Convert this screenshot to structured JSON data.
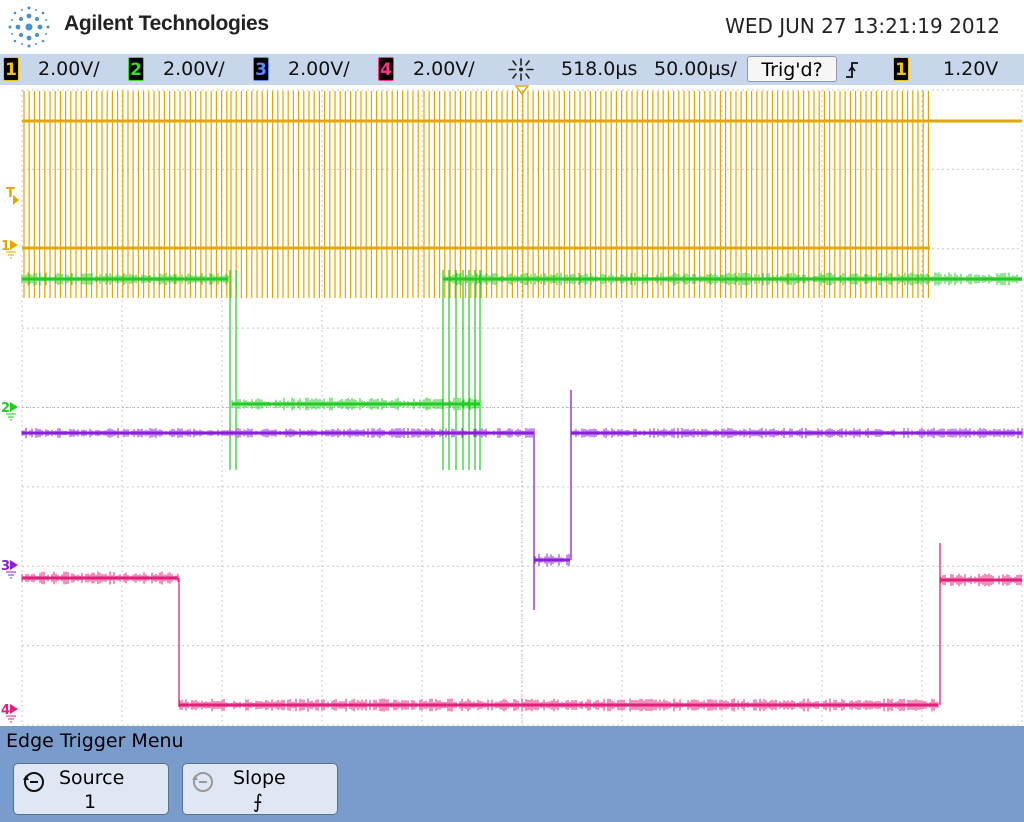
{
  "header": {
    "brand": "Agilent Technologies",
    "datetime": "WED JUN 27 13:21:19 2012"
  },
  "status_bar": {
    "channels": [
      {
        "number": "1",
        "scale": "2.00V/",
        "color": "#e8b400"
      },
      {
        "number": "2",
        "scale": "2.00V/",
        "color": "#33cc33"
      },
      {
        "number": "3",
        "scale": "2.00V/",
        "color": "#6688ff"
      },
      {
        "number": "4",
        "scale": "2.00V/",
        "color": "#ee2277"
      }
    ],
    "delay": "518.0µs",
    "timebase": "50.00µs/",
    "trigger_state": "Trig'd?",
    "trigger_slope_icon": "rising-edge-icon",
    "trigger_source": "1",
    "trigger_level": "1.20V"
  },
  "markers": {
    "trigger": "T",
    "ch1": "1",
    "ch2": "2",
    "ch3": "3",
    "ch4": "4"
  },
  "traces": {
    "ch1_color": "#e0a800",
    "ch2_color": "#22cc22",
    "ch3_color": "#8a1fd8",
    "ch4_color": "#e0207a"
  },
  "menu": {
    "title": "Edge Trigger Menu",
    "softkeys": [
      {
        "label": "Source",
        "value": "1",
        "icon": "rotate-knob-icon"
      },
      {
        "label": "Slope",
        "value": "⨍",
        "icon": "rotate-knob-icon"
      }
    ]
  }
}
